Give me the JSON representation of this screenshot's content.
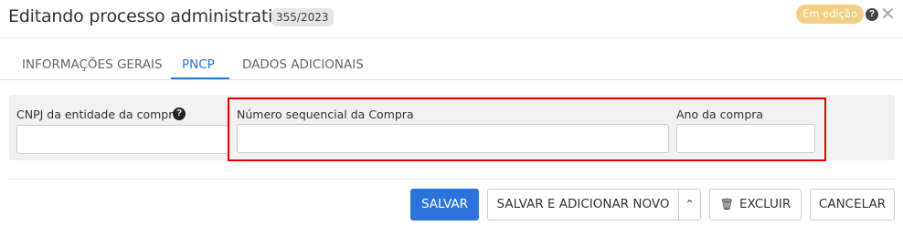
{
  "header": {
    "title": "Editando processo administrativo",
    "process_number": "355/2023",
    "status": "Em edição",
    "help_icon": "question-circle-icon",
    "close_icon": "close-icon"
  },
  "tabs": [
    {
      "label": "INFORMAÇÕES GERAIS",
      "active": false
    },
    {
      "label": "PNCP",
      "active": true
    },
    {
      "label": "DADOS ADICIONAIS",
      "active": false
    }
  ],
  "form": {
    "cnpj": {
      "label": "CNPJ da entidade da compra",
      "value": ""
    },
    "numero_sequencial": {
      "label": "Número sequencial da Compra",
      "value": ""
    },
    "ano": {
      "label": "Ano da compra",
      "value": ""
    }
  },
  "footer": {
    "save": "SALVAR",
    "save_and_new": "SALVAR E ADICIONAR NOVO",
    "delete": "EXCLUIR",
    "cancel": "CANCELAR"
  },
  "colors": {
    "primary": "#2d74da",
    "status_badge": "#f2cf82",
    "highlight": "#e00000"
  }
}
